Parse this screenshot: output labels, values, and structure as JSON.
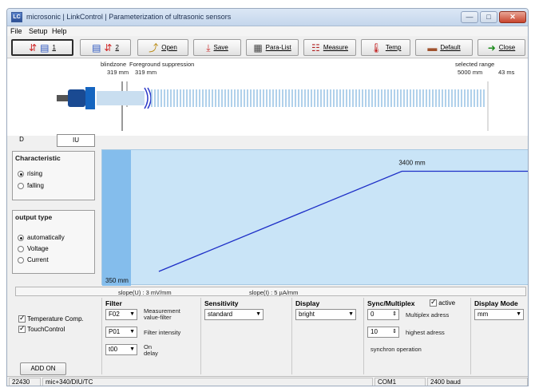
{
  "window": {
    "title": "microsonic | LinkControl | Parameterization of ultrasonic sensors",
    "app_icon": "LC"
  },
  "menu": [
    "File",
    "Setup",
    "Help"
  ],
  "toolbar": {
    "sensor1_label": "1",
    "sensor2_label": "2",
    "open": "Open",
    "save": "Save",
    "paralist": "Para-List",
    "measure": "Measure",
    "temp": "Temp",
    "default": "Default",
    "close": "Close"
  },
  "measure": {
    "blindzone_label": "blindzone",
    "foreground_label": "Foreground suppression",
    "blindzone_value": "319 mm",
    "foreground_value": "319 mm",
    "range_label": "selected range",
    "range_value": "5000 mm",
    "time_value": "43 ms"
  },
  "tabs": {
    "d": "D",
    "iu": "IU"
  },
  "characteristic": {
    "title": "Characteristic",
    "options": [
      "rising",
      "falling"
    ],
    "selected": "rising"
  },
  "output_type": {
    "title": "output type",
    "options": [
      "automatically",
      "Voltage",
      "Current"
    ],
    "selected": "automatically"
  },
  "chart_data": {
    "type": "line",
    "x": [
      350,
      3400,
      5000
    ],
    "y": [
      0,
      1,
      1
    ],
    "annotations": [
      "350 mm",
      "3400 mm"
    ],
    "xlim": [
      0,
      5000
    ],
    "ylim": [
      0,
      1.1
    ]
  },
  "slope": {
    "u": "slope(U) : 3 mV/mm",
    "i": "slope(I) : 5 µA/mm"
  },
  "checkboxes": {
    "temperature": "Temperature Comp.",
    "touchcontrol": "TouchControl",
    "addon": "ADD ON"
  },
  "filter": {
    "title": "Filter",
    "measurement_value": "F02",
    "measurement_label": "Measurement value-filter",
    "intensity_value": "P01",
    "intensity_label": "Filter intensity",
    "delay_value": "t00",
    "delay_label": "On delay"
  },
  "sensitivity": {
    "title": "Sensitivity",
    "value": "standard"
  },
  "display": {
    "title": "Display",
    "value": "bright"
  },
  "sync": {
    "title": "Sync/Multiplex",
    "active_label": "active",
    "multiplex_value": "0",
    "multiplex_label": "Multiplex adress",
    "highest_value": "10",
    "highest_label": "highest adress",
    "operation": "synchron operation"
  },
  "display_mode": {
    "title": "Display Mode",
    "value": "mm"
  },
  "status": {
    "serial": "22430",
    "model": "mic+340/DIU/TC",
    "port": "COM1",
    "baud": "2400 baud"
  }
}
